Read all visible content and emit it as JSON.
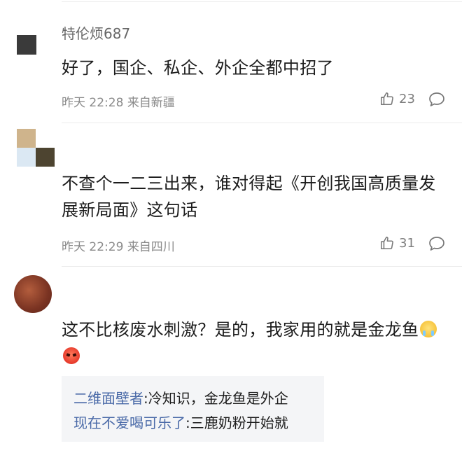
{
  "icons": {
    "like": "thumbs-up-icon",
    "reply": "speech-bubble-icon",
    "emoji_1": "crying-face-emoji",
    "emoji_2": "angry-face-emoji"
  },
  "colors": {
    "reply_name": "#4a6aa8",
    "meta_text": "#8a8a8a",
    "reply_box_bg": "#f4f5f7"
  },
  "comments": [
    {
      "username": "特伦烦687",
      "text": "好了，国企、私企、外企全都中招了",
      "time": "昨天 22:28",
      "location": "来自新疆",
      "likes": "23"
    },
    {
      "username": "",
      "text": "不查个一二三出来，谁对得起《开创我国高质量发展新局面》这句话",
      "time": "昨天 22:29",
      "location": "来自四川",
      "likes": "31"
    },
    {
      "username": "",
      "text": "这不比核废水刺激？是的，我家用的就是金龙鱼",
      "replies": [
        {
          "name": "二维面壁者",
          "text": ":冷知识，金龙鱼是外企"
        },
        {
          "name": "现在不爱喝可乐了",
          "text": ":三鹿奶粉开始就"
        }
      ]
    }
  ]
}
